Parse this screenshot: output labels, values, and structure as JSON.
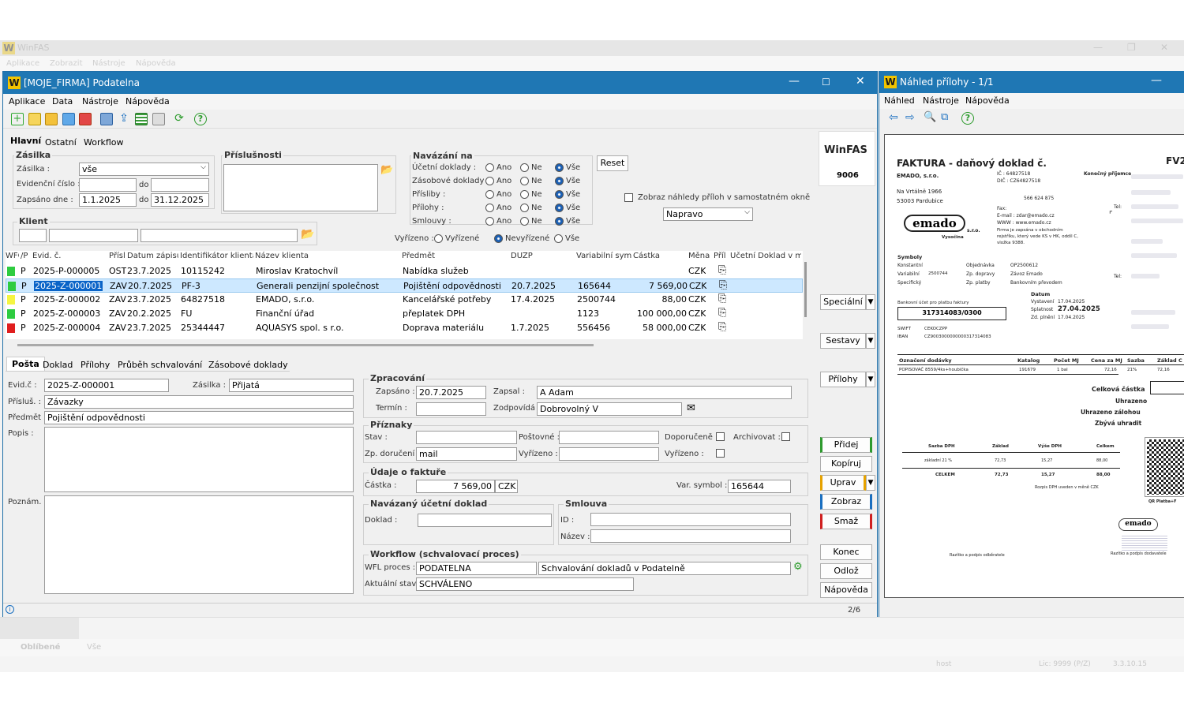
{
  "background": {
    "title": "WinFAS",
    "menu": [
      "Aplikace",
      "Zobrazit",
      "Nástroje",
      "Nápověda"
    ],
    "taskbar": {
      "fav": "Oblíbené",
      "all": "Vše",
      "host": "host",
      "lic": "Lic: 9999 (P/Z)",
      "ver": "3.3.10.15"
    }
  },
  "main": {
    "title": "[MOJE_FIRMA] Podatelna",
    "menu": [
      "Aplikace",
      "Data",
      "Nástroje",
      "Nápověda"
    ],
    "tabs": [
      "Hlavní",
      "Ostatní",
      "Workflow"
    ],
    "filters": {
      "zasilka_group": "Zásilka",
      "zasilka_label": "Zásilka :",
      "zasilka_value": "vše",
      "evid_label": "Evidenční číslo :",
      "do": "do",
      "zapsano_label": "Zapsáno dne :",
      "date_from": "1.1.2025",
      "date_to": "31.12.2025",
      "klient_group": "Klient",
      "prislusnosti": "Příslušnosti",
      "navazani": "Navázání na",
      "nav_rows": [
        "Účetní doklady :",
        "Zásobové doklady :",
        "Přísliby :",
        "Přílohy :",
        "Smlouvy :"
      ],
      "ano": "Ano",
      "ne": "Ne",
      "vse": "Vše",
      "reset": "Reset",
      "vyrizeno_label": "Vyřízeno :",
      "vyrizene": "Vyřízené",
      "nevyrizene": "Nevyřízené",
      "show_preview": "Zobraz náhledy příloh v samostatném okně",
      "position": "Napravo"
    },
    "logo": "WinFAS",
    "logo_num": "9006",
    "grid": {
      "headers": [
        "WFO",
        "/P",
        "Evid. č.",
        "Přísl",
        "Datum zápisu",
        "Identifikátor klienta",
        "Název klienta",
        "Předmět",
        "DUZP",
        "Variabilní symbol",
        "Částka",
        "Měna",
        "Příl",
        "Účetní Doklad v mo"
      ],
      "rows": [
        {
          "flag": "#2ecc40",
          "p": "P",
          "evid": "2025-P-000005",
          "prisl": "OST",
          "date": "23.7.2025",
          "ident": "10115242",
          "name": "Miroslav Kratochvíl",
          "subject": "Nabídka služeb",
          "duzp": "",
          "vs": "",
          "amount": "",
          "cur": "CZK"
        },
        {
          "flag": "#2ecc40",
          "p": "P",
          "evid": "2025-Z-000001",
          "prisl": "ZAV",
          "date": "20.7.2025",
          "ident": "PF-3",
          "name": "Generali penzijní společnost",
          "subject": "Pojištění odpovědnosti",
          "duzp": "20.7.2025",
          "vs": "165644",
          "amount": "7 569,00",
          "cur": "CZK"
        },
        {
          "flag": "#f5f542",
          "p": "P",
          "evid": "2025-Z-000002",
          "prisl": "ZAV",
          "date": "23.7.2025",
          "ident": "64827518",
          "name": "EMADO, s.r.o.",
          "subject": "Kancelářské potřeby",
          "duzp": "17.4.2025",
          "vs": "2500744",
          "amount": "88,00",
          "cur": "CZK"
        },
        {
          "flag": "#2ecc40",
          "p": "P",
          "evid": "2025-Z-000003",
          "prisl": "ZAV",
          "date": "20.2.2025",
          "ident": "FU",
          "name": "Finanční úřad",
          "subject": "přeplatek DPH",
          "duzp": "",
          "vs": "1123",
          "amount": "100 000,00",
          "cur": "CZK"
        },
        {
          "flag": "#e01e1e",
          "p": "P",
          "evid": "2025-Z-000004",
          "prisl": "ZAV",
          "date": "23.7.2025",
          "ident": "25344447",
          "name": "AQUASYS spol. s r.o.",
          "subject": "Doprava materiálu",
          "duzp": "1.7.2025",
          "vs": "556456",
          "amount": "58 000,00",
          "cur": "CZK"
        }
      ]
    },
    "side_buttons": [
      "Speciální",
      "Sestavy",
      "Přílohy",
      "Přidej",
      "Kopíruj",
      "Uprav",
      "Zobraz",
      "Smaž",
      "Konec",
      "Odlož",
      "Nápověda"
    ],
    "detail_tabs": [
      "Pošta",
      "Doklad",
      "Přílohy",
      "Průběh schvalování",
      "Zásobové doklady"
    ],
    "detail": {
      "evid_label": "Evid.č :",
      "evid": "2025-Z-000001",
      "zasilka_label": "Zásilka :",
      "zasilka": "Přijatá",
      "prislus_label": "Přísluš. :",
      "prislus": "Závazky",
      "predmet_label": "Předmět :",
      "predmet": "Pojištění odpovědnosti",
      "popis_label": "Popis :",
      "pozn_label": "Poznám. :",
      "zprac_group": "Zpracování",
      "zapsano_label": "Zapsáno :",
      "zapsano": "20.7.2025",
      "zapsal_label": "Zapsal :",
      "zapsal": "A Adam",
      "termin_label": "Termín :",
      "zodp_label": "Zodpovídá :",
      "zodp": "Dobrovolný V",
      "priznaky_group": "Příznaky",
      "stav_label": "Stav :",
      "postovne_label": "Poštovné :",
      "doporucene_label": "Doporučeně :",
      "archivovat_label": "Archivovat :",
      "zpdoruc_label": "Zp. doručení :",
      "zpdoruc": "mail",
      "vyrizeno_label": "Vyřízeno :",
      "vyrizeno2_label": "Vyřízeno :",
      "faktura_group": "Údaje o faktuře",
      "castka_label": "Částka :",
      "castka": "7 569,00",
      "mena": "CZK",
      "varsym_label": "Var. symbol :",
      "varsym": "165644",
      "navuc_group": "Navázaný účetní doklad",
      "doklad_label": "Doklad :",
      "smlouva_group": "Smlouva",
      "id_label": "ID :",
      "nazev_label": "Název :",
      "wfl_group": "Workflow (schvalovací proces)",
      "wfl_label": "WFL proces :",
      "wfl": "PODATELNA",
      "wfl_desc": "Schvalování dokladů v Podatelně",
      "akt_label": "Aktuální stav :",
      "akt": "SCHVÁLENO"
    },
    "status_page": "2/6"
  },
  "preview": {
    "title": "Náhled přílohy - 1/1",
    "menu": [
      "Náhled",
      "Nástroje",
      "Nápověda"
    ],
    "doc": {
      "title": "FAKTURA - daňový doklad č.",
      "num": "FV2",
      "seller": "EMADO, s.r.o.",
      "ic": "IČ : 64827518",
      "dic": "DIČ : CZ64827518",
      "konecny": "Konečný příjemce",
      "street": "Na Vrtálně 1966",
      "city": "53003  Pardubice",
      "phone": "566 624 875",
      "fax": "Fax:",
      "email": "E-mail : zdar@emado.cz",
      "www": "WWW : www.emado.cz",
      "tel": "Tel:",
      "firma": "Firma je zapsána v obchodním",
      "rejstrik": "rejstříku, který vede KS v HK, oddíl C,",
      "vlozka": "vložka 9388.",
      "logo": "emado",
      "logo_sub": "Vysočina",
      "sro": "s.r.o.",
      "symboly": "Symboly",
      "konst": "Konstantní",
      "var": "Variabilní",
      "varval": "2500744",
      "spec": "Specifický",
      "objednavka": "Objednávka",
      "objval": "OP2500612",
      "zpdop": "Zp. dopravy",
      "zpdopval": "Závoz Emado",
      "zpplat": "Zp. platby",
      "zpplatval": "Bankovním převodem",
      "banka": "Bankovní účet pro platbu faktury",
      "ucet": "317314083/0300",
      "swift": "SWIFT",
      "swiftval": "CEKOCZPP",
      "iban": "IBAN",
      "ibanval": "CZ9003000000000317314083",
      "datum": "Datum",
      "vystaveni": "Vystavení",
      "vystval": "17.04.2025",
      "splatnost": "Splatnost",
      "splatval": "27.04.2025",
      "zdpl": "Zd. plnění",
      "zdplval": "17.04.2025",
      "cols": [
        "Označení dodávky",
        "Katalog",
        "Počet MJ",
        "Cena za MJ",
        "Sazba",
        "Základ C"
      ],
      "item": [
        "POPISOVAČ 8559/4ks+houbička",
        "191679",
        "1 bal",
        "72,16",
        "21%",
        "72,16"
      ],
      "celkova": "Celková částka",
      "uhrazeno": "Uhrazeno",
      "uhrzal": "Uhrazeno zálohou",
      "zbyva": "Zbývá uhradit",
      "vat_cols": [
        "Sazba DPH",
        "Základ",
        "Výše DPH",
        "Celkem"
      ],
      "vat_row": [
        "základní 21 %",
        "72,73",
        "15,27",
        "88,00"
      ],
      "vat_total": [
        "CELKEM",
        "72,73",
        "15,27",
        "88,00"
      ],
      "rozpis": "Rozpis DPH uveden v měně CZK",
      "qr": "QR Platba+F",
      "razitko1": "Razítko a podpis odběratele",
      "razitko2": "Razítko a podpis dodavatele"
    }
  }
}
